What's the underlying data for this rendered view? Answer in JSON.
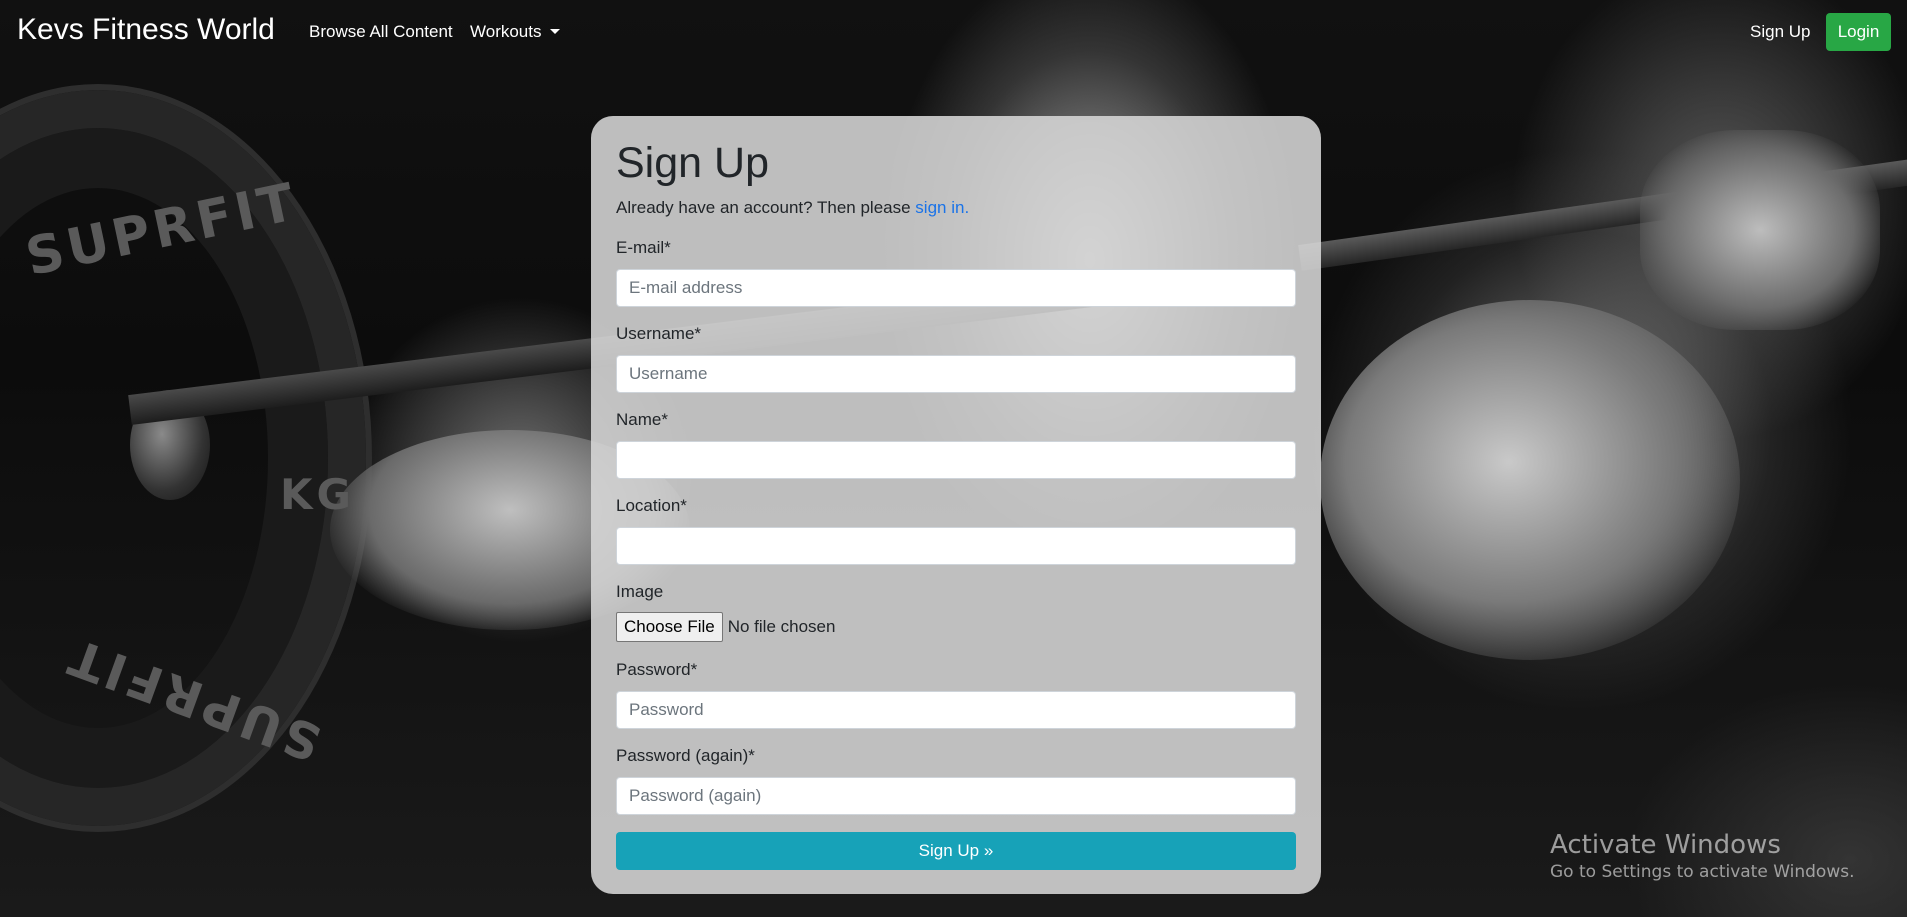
{
  "navbar": {
    "brand": "Kevs Fitness World",
    "browse_label": "Browse All Content",
    "workouts_label": "Workouts",
    "signup_label": "Sign Up",
    "login_label": "Login"
  },
  "background": {
    "plate_text": [
      "SUPRFIT",
      "KG",
      "SUPRFIT"
    ]
  },
  "form": {
    "title": "Sign Up",
    "lead_text": "Already have an account? Then please ",
    "lead_link": "sign in.",
    "email_label": "E-mail*",
    "email_placeholder": "E-mail address",
    "username_label": "Username*",
    "username_placeholder": "Username",
    "name_label": "Name*",
    "location_label": "Location*",
    "image_label": "Image",
    "file_button": "Choose File",
    "file_status": "No file chosen",
    "password_label": "Password*",
    "password_placeholder": "Password",
    "password2_label": "Password (again)*",
    "password2_placeholder": "Password (again)",
    "submit_label": "Sign Up »"
  },
  "watermark": {
    "title": "Activate Windows",
    "subtitle": "Go to Settings to activate Windows."
  },
  "colors": {
    "login_button": "#28a745",
    "submit_button": "#17a2b8",
    "link": "#1a73e8"
  }
}
